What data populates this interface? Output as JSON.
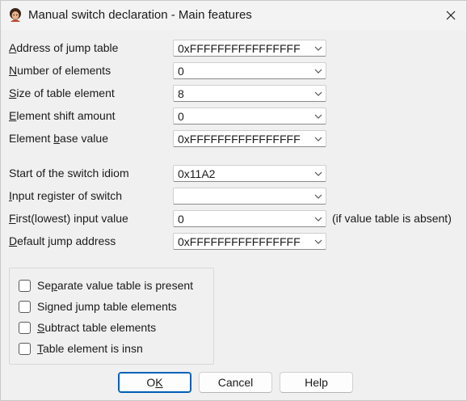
{
  "window": {
    "title": "Manual switch declaration - Main features"
  },
  "fields": [
    {
      "label_u": "A",
      "label_rest": "ddress of jump table",
      "value": "0xFFFFFFFFFFFFFFFF"
    },
    {
      "label_u": "N",
      "label_rest": "umber of elements",
      "value": "0"
    },
    {
      "label_u": "S",
      "label_rest": "ize of table element",
      "value": "8"
    },
    {
      "label_u": "E",
      "label_rest": "lement shift amount",
      "value": "0"
    },
    {
      "label_pre": "Element ",
      "label_u": "b",
      "label_rest": "ase value",
      "value": "0xFFFFFFFFFFFFFFFF"
    },
    {
      "label_pre": "Start of the switch idiom",
      "value": "0x11A2"
    },
    {
      "label_u": "I",
      "label_rest": "nput register of switch",
      "value": ""
    },
    {
      "label_u": "F",
      "label_rest": "irst(lowest) input value",
      "value": "0",
      "hint": "(if value table is absent)"
    },
    {
      "label_u": "D",
      "label_rest": "efault jump address",
      "value": "0xFFFFFFFFFFFFFFFF"
    }
  ],
  "checkboxes": [
    {
      "pre": "Se",
      "u": "p",
      "rest": "arate value table is present",
      "checked": false
    },
    {
      "pre": "Si",
      "u": "g",
      "rest": "ned jump table elements",
      "checked": false
    },
    {
      "pre": "",
      "u": "S",
      "rest": "ubtract table elements",
      "checked": false
    },
    {
      "pre": "",
      "u": "T",
      "rest": "able element is insn",
      "checked": false
    }
  ],
  "buttons": {
    "ok_pre": "O",
    "ok_u": "K",
    "cancel": "Cancel",
    "help": "Help"
  },
  "colors": {
    "accent": "#005fb8",
    "background": "#f0f0f0"
  },
  "icons": {
    "app": "ida-app-icon",
    "close": "close-icon",
    "dropdown": "chevron-down-icon"
  }
}
